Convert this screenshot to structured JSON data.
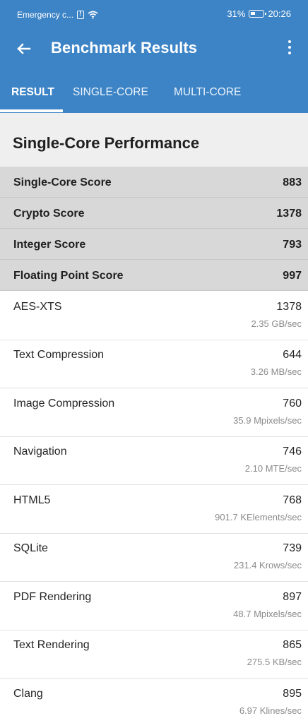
{
  "status_bar": {
    "carrier": "Emergency c...",
    "battery": "31%",
    "time": "20:26"
  },
  "app_bar": {
    "title": "Benchmark Results"
  },
  "tabs": [
    {
      "label": "RESULT",
      "active": true
    },
    {
      "label": "SINGLE-CORE",
      "active": false
    },
    {
      "label": "MULTI-CORE",
      "active": false
    }
  ],
  "section": {
    "title": "Single-Core Performance"
  },
  "summary": [
    {
      "label": "Single-Core Score",
      "value": "883"
    },
    {
      "label": "Crypto Score",
      "value": "1378"
    },
    {
      "label": "Integer Score",
      "value": "793"
    },
    {
      "label": "Floating Point Score",
      "value": "997"
    }
  ],
  "details": [
    {
      "label": "AES-XTS",
      "value": "1378",
      "rate": "2.35 GB/sec"
    },
    {
      "label": "Text Compression",
      "value": "644",
      "rate": "3.26 MB/sec"
    },
    {
      "label": "Image Compression",
      "value": "760",
      "rate": "35.9 Mpixels/sec"
    },
    {
      "label": "Navigation",
      "value": "746",
      "rate": "2.10 MTE/sec"
    },
    {
      "label": "HTML5",
      "value": "768",
      "rate": "901.7 KElements/sec"
    },
    {
      "label": "SQLite",
      "value": "739",
      "rate": "231.4 Krows/sec"
    },
    {
      "label": "PDF Rendering",
      "value": "897",
      "rate": "48.7 Mpixels/sec"
    },
    {
      "label": "Text Rendering",
      "value": "865",
      "rate": "275.5 KB/sec"
    },
    {
      "label": "Clang",
      "value": "895",
      "rate": "6.97 Klines/sec"
    }
  ],
  "colors": {
    "primary": "#3d84c6",
    "summary_background": "#d8d8d8",
    "header_background": "#efefef"
  },
  "icons": {
    "back": "arrow-left-icon",
    "more": "vertical-dots-icon",
    "wifi": "wifi-icon",
    "battery": "battery-icon"
  }
}
